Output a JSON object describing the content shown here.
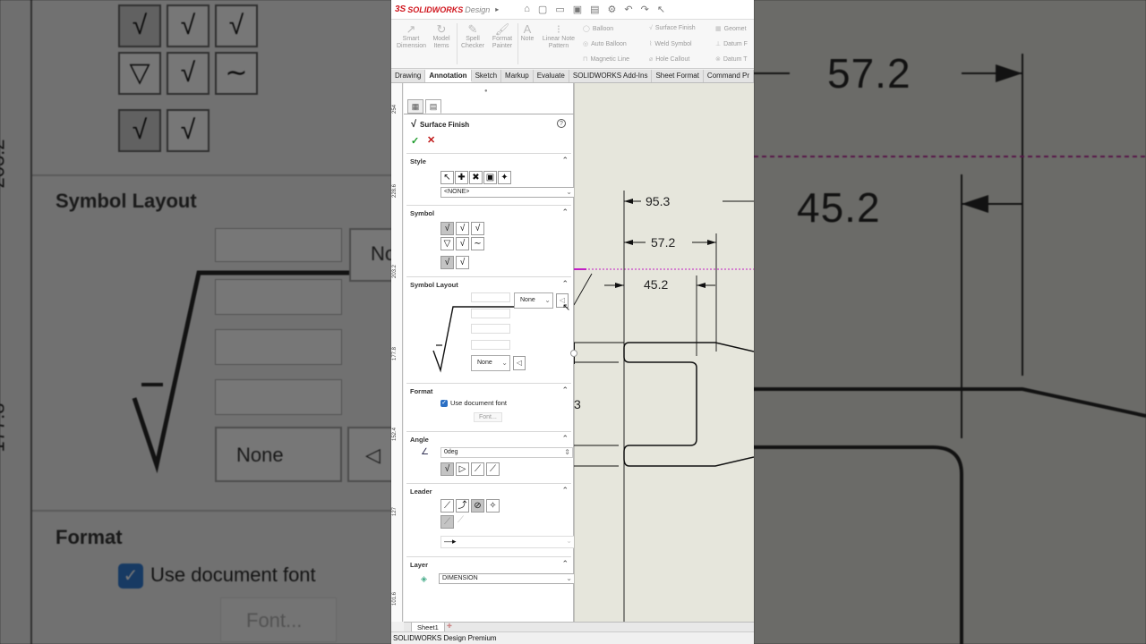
{
  "app": {
    "brand_ds": "3S",
    "brand_sw": "SOLIDWORKS",
    "brand_design": "Design",
    "status_text": "SOLIDWORKS Design Premium"
  },
  "ribbon": {
    "smart_dimension": "Smart Dimension",
    "model_items": "Model Items",
    "spell_checker": "Spell Checker",
    "format_painter": "Format Painter",
    "note": "Note",
    "linear_note_pattern": "Linear Note Pattern",
    "balloon": "Balloon",
    "auto_balloon": "Auto Balloon",
    "magnetic_line": "Magnetic Line",
    "surface_finish": "Surface Finish",
    "weld_symbol": "Weld Symbol",
    "hole_callout": "Hole Callout",
    "geometric": "Geomet",
    "datum_f": "Datum F",
    "datum_t": "Datum T"
  },
  "tabs": [
    "Drawing",
    "Annotation",
    "Sketch",
    "Markup",
    "Evaluate",
    "SOLIDWORKS Add-Ins",
    "Sheet Format",
    "Command Pr"
  ],
  "ruler": [
    "254",
    "228.6",
    "203.2",
    "177.8",
    "152.4",
    "127",
    "101.6"
  ],
  "pm": {
    "title": "Surface Finish",
    "help": "?",
    "style": {
      "header": "Style",
      "value": "<NONE>"
    },
    "symbol": {
      "header": "Symbol"
    },
    "layout": {
      "header": "Symbol Layout",
      "combo1": "None",
      "combo2": "None"
    },
    "format": {
      "header": "Format",
      "use_doc_font": "Use document font",
      "font_button": "Font..."
    },
    "angle": {
      "header": "Angle",
      "value": "0deg"
    },
    "leader": {
      "header": "Leader"
    },
    "layer": {
      "header": "Layer",
      "value": "DIMENSION"
    }
  },
  "canvas": {
    "dim_95": "95.3",
    "dim_57": "57.2",
    "dim_45": "45.2",
    "dim_partial": "3"
  },
  "sheet_tab": "Sheet1",
  "bg_left": {
    "symbol_layout": "Symbol Layout",
    "none": "None",
    "none_partial": "No",
    "format": "Format",
    "use_doc_font": "Use document font",
    "font": "Font...",
    "ruler1": "203.2",
    "ruler2": "177.8"
  },
  "bg_right": {
    "n1": "57.2",
    "n2": "45.2"
  }
}
